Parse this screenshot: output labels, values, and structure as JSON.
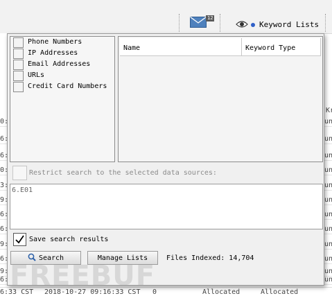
{
  "toolbar": {
    "mail_badge": "12",
    "keyword_lists_label": "Keyword Lists"
  },
  "background": {
    "left_fragments": [
      "0:",
      "6:",
      "6:",
      "0:",
      "3:",
      "9:",
      "6:",
      "6:",
      "9:",
      "6:",
      "9:",
      "6:"
    ],
    "right_header": "Kr",
    "right_fragments": [
      "un",
      "un",
      "un",
      "un",
      "un",
      "un",
      "un",
      "un",
      "un",
      "un",
      "un",
      "un"
    ],
    "bottom_row": [
      "6:33 CST",
      "2018-10-27 09:16:33 CST",
      "0",
      "Allocated",
      "Allocated"
    ]
  },
  "panel": {
    "list_items": [
      {
        "label": "Phone Numbers"
      },
      {
        "label": "IP Addresses"
      },
      {
        "label": "Email Addresses"
      },
      {
        "label": "URLs"
      },
      {
        "label": "Credit Card Numbers"
      }
    ],
    "columns": [
      "Name",
      "Keyword Type"
    ],
    "restrict_label": "Restrict search to the selected data sources:",
    "search_value": "6.E01",
    "save_label": "Save search results",
    "search_button": "Search",
    "manage_button": "Manage Lists",
    "files_indexed": "Files Indexed: 14,704",
    "watermark": "FREEBUF"
  }
}
